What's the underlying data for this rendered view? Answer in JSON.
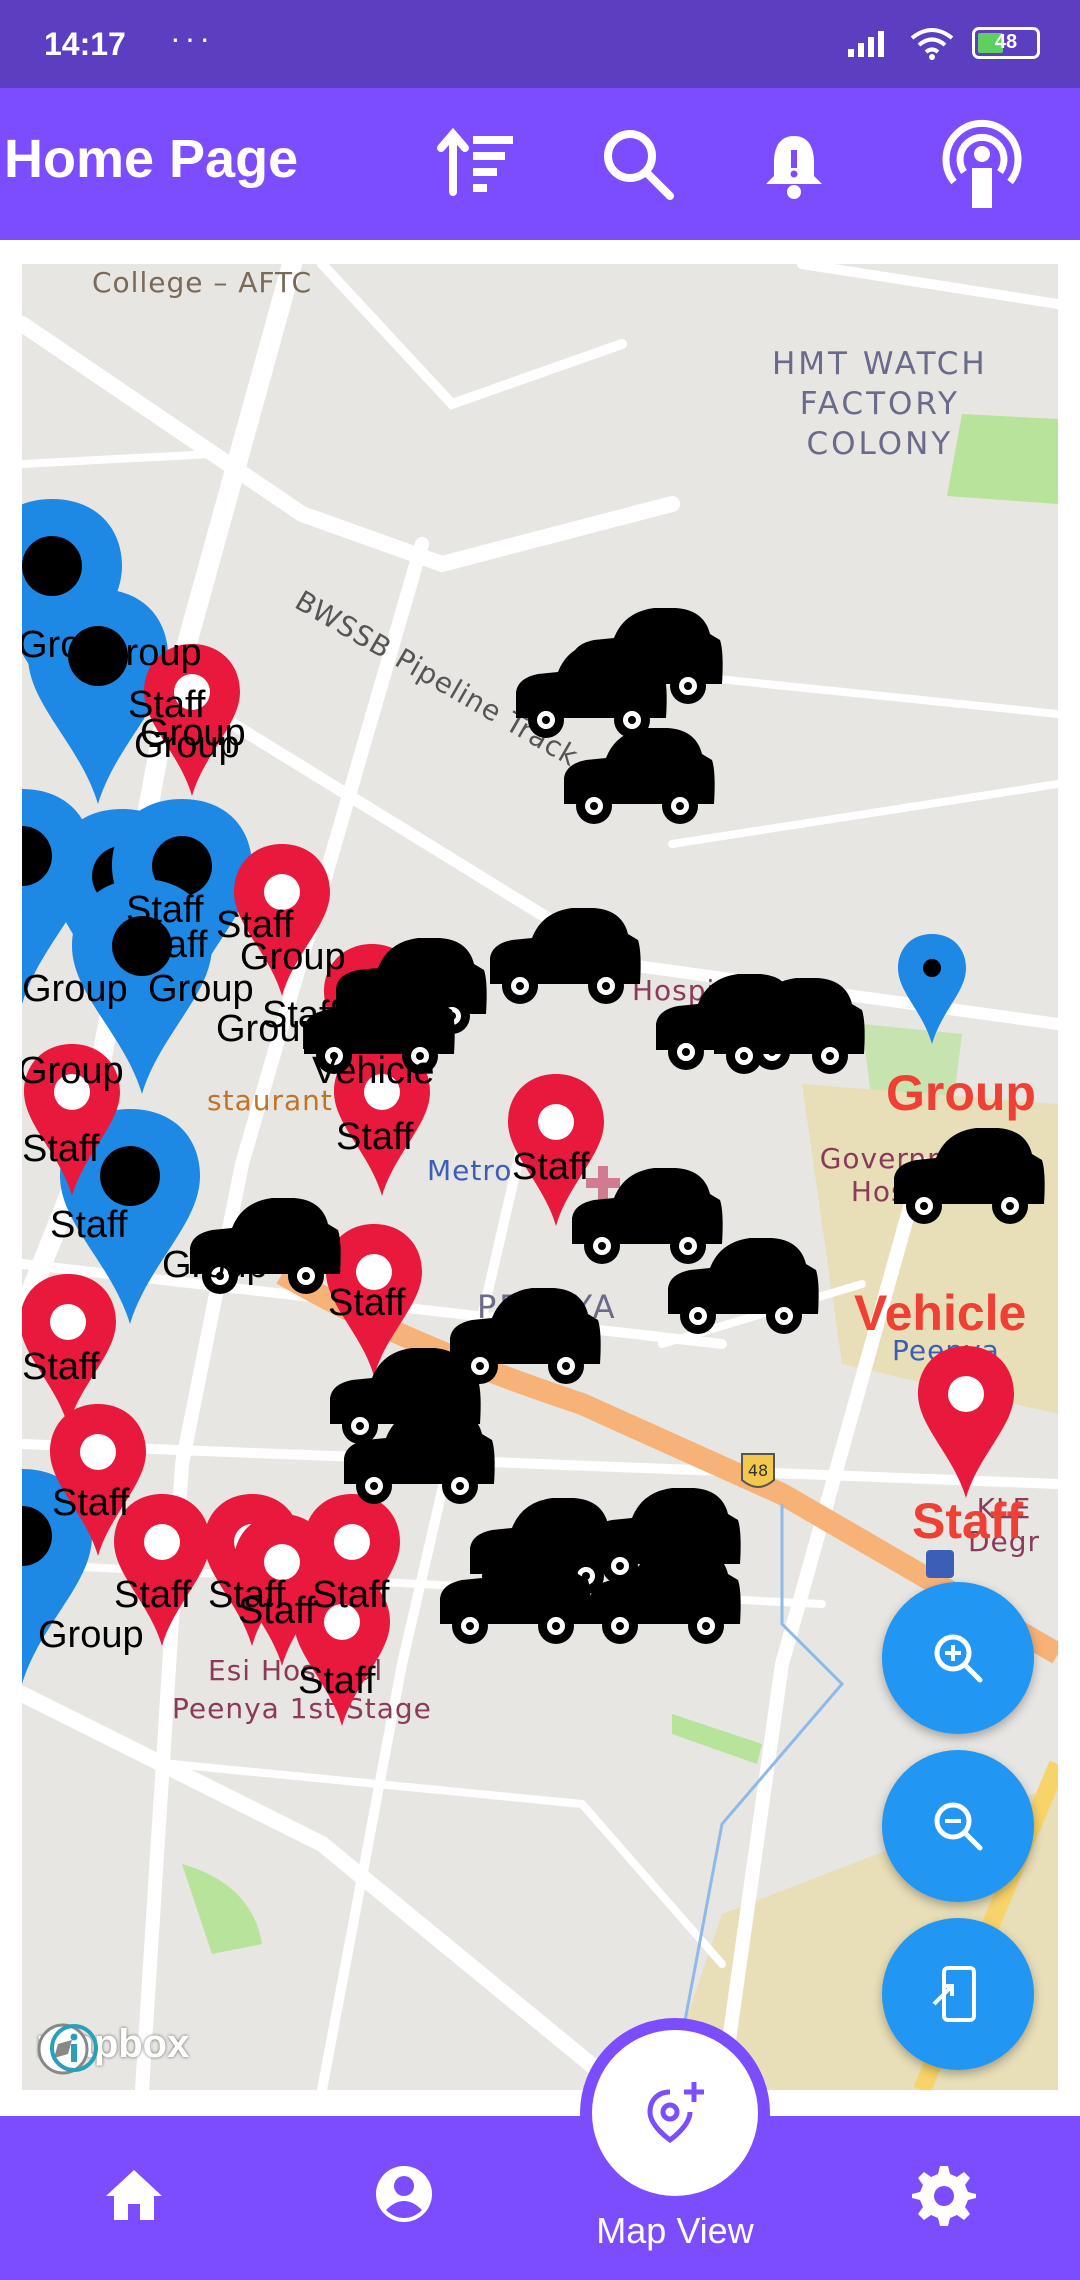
{
  "status_bar": {
    "time": "14:17",
    "dots": "···",
    "battery": "48"
  },
  "app_bar": {
    "title": "Home Page"
  },
  "map": {
    "labels": {
      "college": "College – AFTC",
      "hmt": "HMT WATCH\nFACTORY\nCOLONY",
      "bwssb": "BWSSB Pipeline Track",
      "hospital": "Hospital",
      "restaurant": "staurant",
      "metro": "Metro",
      "peenya": "PEENYA",
      "gov_hospital": "Government Hospital",
      "peenya_station": "Peenya",
      "kle": "KLE Degr",
      "esi": "Esi Hospital",
      "peenya_stage": "Peenya 1st Stage",
      "road_number": "48"
    },
    "pin_labels": {
      "staff": "Staff",
      "group": "Group",
      "vehicle": "Vehicle"
    },
    "legend": {
      "group": "Group",
      "vehicle": "Vehicle",
      "staff": "Staff"
    },
    "attribution": "mapbox"
  },
  "bottom_nav": {
    "map_view_label": "Map View"
  }
}
